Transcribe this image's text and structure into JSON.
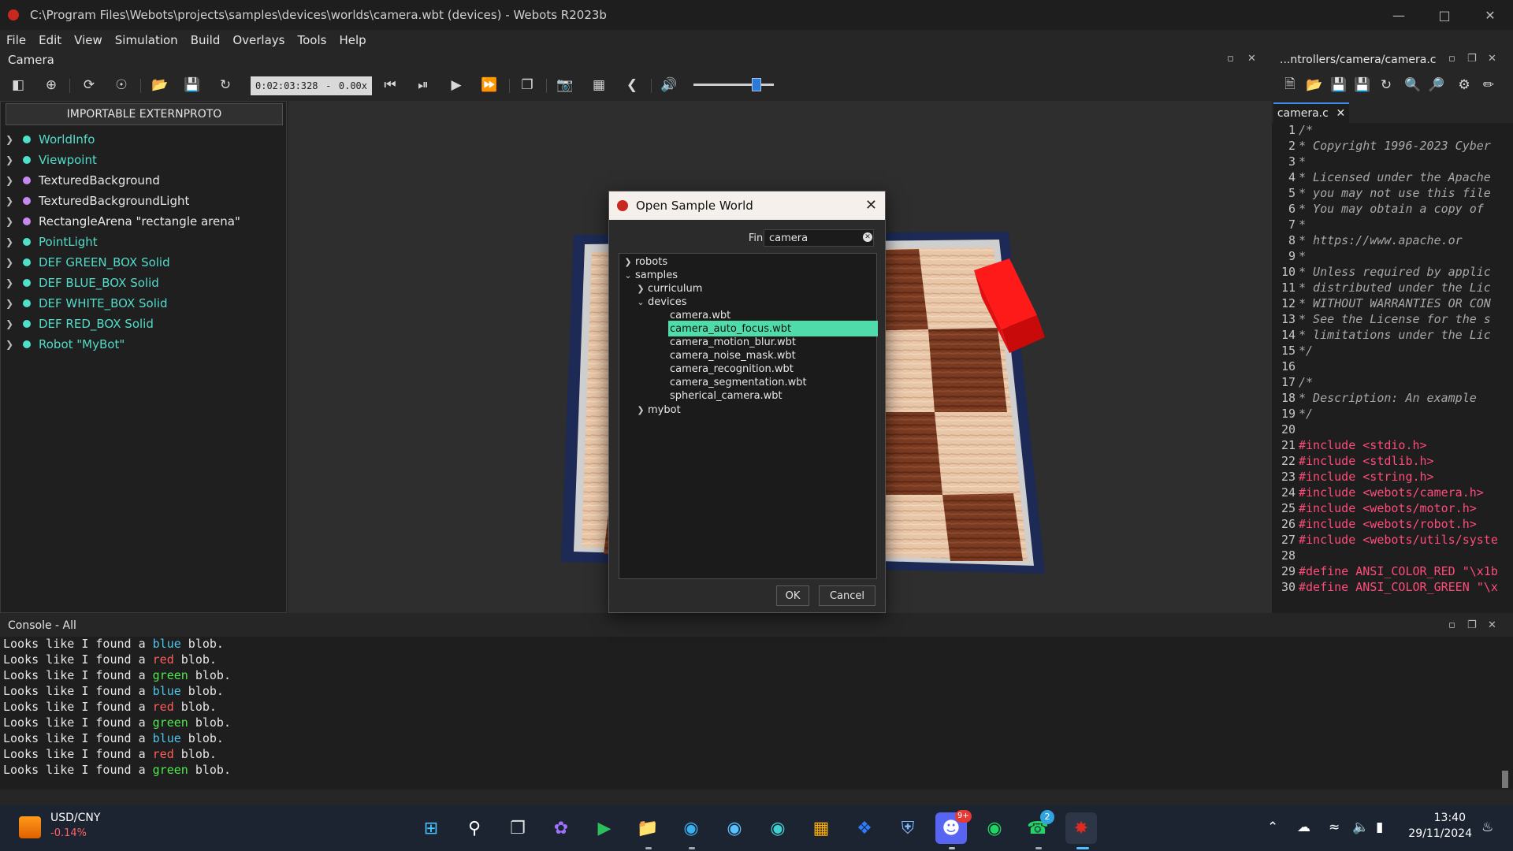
{
  "window": {
    "title": "C:\\Program Files\\Webots\\projects\\samples\\devices\\worlds\\camera.wbt (devices) - Webots R2023b"
  },
  "menu": [
    "File",
    "Edit",
    "View",
    "Simulation",
    "Build",
    "Overlays",
    "Tools",
    "Help"
  ],
  "camera_panel": {
    "title": "Camera"
  },
  "toolbar": {
    "time": "0:02:03:328",
    "separator": "-",
    "speed": "0.00x"
  },
  "scene_tree": {
    "import_button": "IMPORTABLE EXTERNPROTO",
    "nodes": [
      {
        "label": "WorldInfo",
        "kind": "cyan"
      },
      {
        "label": "Viewpoint",
        "kind": "cyan"
      },
      {
        "label": "TexturedBackground",
        "kind": "purple"
      },
      {
        "label": "TexturedBackgroundLight",
        "kind": "purple"
      },
      {
        "label": "RectangleArena \"rectangle arena\"",
        "kind": "purple"
      },
      {
        "label": "PointLight",
        "kind": "cyan"
      },
      {
        "label": "DEF GREEN_BOX Solid",
        "kind": "cyan"
      },
      {
        "label": "DEF BLUE_BOX Solid",
        "kind": "cyan"
      },
      {
        "label": "DEF WHITE_BOX Solid",
        "kind": "cyan"
      },
      {
        "label": "DEF RED_BOX Solid",
        "kind": "cyan"
      },
      {
        "label": "Robot \"MyBot\"",
        "kind": "cyan"
      }
    ]
  },
  "dialog": {
    "title": "Open Sample World",
    "find_label": "Find :",
    "find_value": "camera",
    "tree": {
      "robots": "robots",
      "samples": "samples",
      "curriculum": "curriculum",
      "devices": "devices",
      "files": [
        "camera.wbt",
        "camera_auto_focus.wbt",
        "camera_motion_blur.wbt",
        "camera_noise_mask.wbt",
        "camera_recognition.wbt",
        "camera_segmentation.wbt",
        "spherical_camera.wbt"
      ],
      "selected_index": 1,
      "mybot": "mybot"
    },
    "ok": "OK",
    "cancel": "Cancel"
  },
  "editor": {
    "header": "...ntrollers/camera/camera.c",
    "tab": "camera.c",
    "lines": [
      {
        "n": "1",
        "text": "/*",
        "kind": "cm"
      },
      {
        "n": "2",
        "text": " * Copyright 1996-2023 Cyber",
        "kind": "cm"
      },
      {
        "n": "3",
        "text": " *",
        "kind": "cm"
      },
      {
        "n": "4",
        "text": " * Licensed under the Apache",
        "kind": "cm"
      },
      {
        "n": "5",
        "text": " * you may not use this file",
        "kind": "cm"
      },
      {
        "n": "6",
        "text": " * You may obtain a copy of",
        "kind": "cm"
      },
      {
        "n": "7",
        "text": " *",
        "kind": "cm"
      },
      {
        "n": "8",
        "text": " *     https://www.apache.or",
        "kind": "cm"
      },
      {
        "n": "9",
        "text": " *",
        "kind": "cm"
      },
      {
        "n": "10",
        "text": " * Unless required by applic",
        "kind": "cm"
      },
      {
        "n": "11",
        "text": " * distributed under the Lic",
        "kind": "cm"
      },
      {
        "n": "12",
        "text": " * WITHOUT WARRANTIES OR CON",
        "kind": "cm"
      },
      {
        "n": "13",
        "text": " * See the License for the s",
        "kind": "cm"
      },
      {
        "n": "14",
        "text": " * limitations under the Lic",
        "kind": "cm"
      },
      {
        "n": "15",
        "text": " */",
        "kind": "cm"
      },
      {
        "n": "16",
        "text": "",
        "kind": "cm"
      },
      {
        "n": "17",
        "text": "/*",
        "kind": "cm"
      },
      {
        "n": "18",
        "text": " * Description:  An example",
        "kind": "cm"
      },
      {
        "n": "19",
        "text": " */",
        "kind": "cm"
      },
      {
        "n": "20",
        "text": "",
        "kind": "cm"
      },
      {
        "n": "21",
        "text": "#include <stdio.h>",
        "kind": "pp"
      },
      {
        "n": "22",
        "text": "#include <stdlib.h>",
        "kind": "pp"
      },
      {
        "n": "23",
        "text": "#include <string.h>",
        "kind": "pp"
      },
      {
        "n": "24",
        "text": "#include <webots/camera.h>",
        "kind": "pp"
      },
      {
        "n": "25",
        "text": "#include <webots/motor.h>",
        "kind": "pp"
      },
      {
        "n": "26",
        "text": "#include <webots/robot.h>",
        "kind": "pp"
      },
      {
        "n": "27",
        "text": "#include <webots/utils/syste",
        "kind": "pp"
      },
      {
        "n": "28",
        "text": "",
        "kind": "pp"
      },
      {
        "n": "29",
        "text": "#define ANSI_COLOR_RED \"\\x1b",
        "kind": "pp"
      },
      {
        "n": "30",
        "text": "#define ANSI_COLOR_GREEN \"\\x",
        "kind": "pp"
      }
    ]
  },
  "console": {
    "title": "Console - All",
    "prefix": "Looks like I found a ",
    "suffix": " blob.",
    "colors": [
      "blue",
      "red",
      "green",
      "blue",
      "red",
      "green",
      "blue",
      "red",
      "green"
    ]
  },
  "taskbar": {
    "ticker_name": "USD/CNY",
    "ticker_change": "-0.14%",
    "time": "13:40",
    "date": "29/11/2024",
    "discord_badge": "9+",
    "whatsapp_badge": "2"
  },
  "colors": {
    "blue": "#4ec6e8",
    "red": "#ff5c5c",
    "green": "#4ee84e",
    "selection": "#4fdcaa",
    "accent": "#2c79d6"
  }
}
